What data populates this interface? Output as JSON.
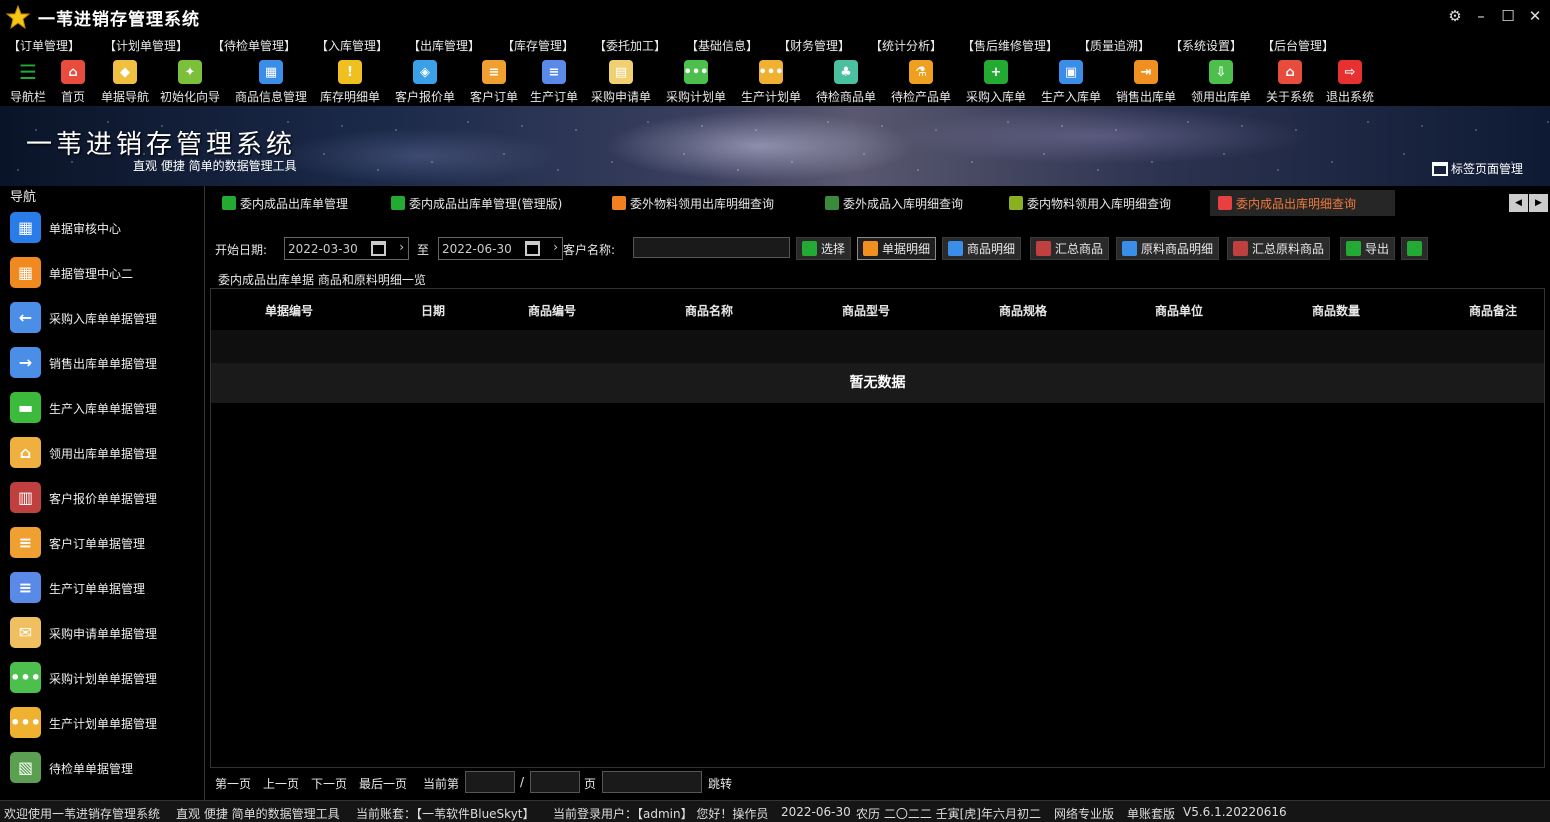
{
  "window": {
    "title": "一苇进销存管理系统",
    "controls": [
      "settings-icon",
      "minimize-icon",
      "maximize-icon",
      "close-icon"
    ]
  },
  "menu": [
    "【订单管理】",
    "【计划单管理】",
    "【待检单管理】",
    "【入库管理】",
    "【出库管理】",
    "【库存管理】",
    "【委托加工】",
    "【基础信息】",
    "【财务管理】",
    "【统计分析】",
    "【售后维修管理】",
    "【质量追溯】",
    "【系统设置】",
    "【后台管理】"
  ],
  "toolbar": [
    {
      "label": "导航栏",
      "icon": "menu-icon",
      "color": "#22aa33"
    },
    {
      "label": "首页",
      "icon": "home-icon",
      "color": "#e84c3d"
    },
    {
      "label": "单据导航",
      "icon": "compass-icon",
      "color": "#f0c040"
    },
    {
      "label": "初始化向导",
      "icon": "wand-icon",
      "color": "#7bbf3a"
    },
    {
      "label": "商品信息管理",
      "icon": "cubes-icon",
      "color": "#3a8ee8"
    },
    {
      "label": "库存明细单",
      "icon": "warning-icon",
      "color": "#f0c020"
    },
    {
      "label": "客户报价单",
      "icon": "tag-icon",
      "color": "#3aa0e8"
    },
    {
      "label": "客户订单",
      "icon": "document-icon",
      "color": "#f0a030"
    },
    {
      "label": "生产订单",
      "icon": "document-icon",
      "color": "#5a8ae8"
    },
    {
      "label": "采购申请单",
      "icon": "form-icon",
      "color": "#f0d070"
    },
    {
      "label": "采购计划单",
      "icon": "chat-icon",
      "color": "#4cbf4c"
    },
    {
      "label": "生产计划单",
      "icon": "chat-icon",
      "color": "#f0b030"
    },
    {
      "label": "待检商品单",
      "icon": "leaf-icon",
      "color": "#4ac0a0"
    },
    {
      "label": "待检产品单",
      "icon": "flask-icon",
      "color": "#f0a020"
    },
    {
      "label": "采购入库单",
      "icon": "plus-icon",
      "color": "#22aa33"
    },
    {
      "label": "生产入库单",
      "icon": "cart-icon",
      "color": "#3a8ee8"
    },
    {
      "label": "销售出库单",
      "icon": "export-icon",
      "color": "#f09020"
    },
    {
      "label": "领用出库单",
      "icon": "download-icon",
      "color": "#4cbf4c"
    },
    {
      "label": "关于系统",
      "icon": "home-icon",
      "color": "#e84c3d"
    },
    {
      "label": "退出系统",
      "icon": "exit-icon",
      "color": "#e83030"
    }
  ],
  "banner": {
    "title": "一苇进销存管理系统",
    "subtitle": "直观 便捷 简单的数据管理工具",
    "tab_manager": "标签页面管理"
  },
  "nav": {
    "title": "导航",
    "items": [
      {
        "label": "单据审核中心",
        "icon": "grid-icon",
        "color": "#2a7de8"
      },
      {
        "label": "单据管理中心二",
        "icon": "grid-icon",
        "color": "#f08a20"
      },
      {
        "label": "采购入库单单据管理",
        "icon": "arrow-left-icon",
        "color": "#4a8ee8"
      },
      {
        "label": "销售出库单单据管理",
        "icon": "arrow-right-icon",
        "color": "#4a8ee8"
      },
      {
        "label": "生产入库单单据管理",
        "icon": "folder-icon",
        "color": "#3cba3c"
      },
      {
        "label": "领用出库单单据管理",
        "icon": "house-icon",
        "color": "#f0b040"
      },
      {
        "label": "客户报价单单据管理",
        "icon": "books-icon",
        "color": "#c04040"
      },
      {
        "label": "客户订单单据管理",
        "icon": "document-icon",
        "color": "#f0a030"
      },
      {
        "label": "生产订单单据管理",
        "icon": "document-icon",
        "color": "#5a8ae8"
      },
      {
        "label": "采购申请单单据管理",
        "icon": "envelope-icon",
        "color": "#f0c060"
      },
      {
        "label": "采购计划单单据管理",
        "icon": "chat-icon",
        "color": "#4cbf4c"
      },
      {
        "label": "生产计划单单据管理",
        "icon": "chat-icon",
        "color": "#f0b030"
      },
      {
        "label": "待检单单据管理",
        "icon": "clipboard-icon",
        "color": "#5aa050"
      }
    ]
  },
  "tabs": [
    {
      "label": "委内成品出库单管理",
      "color": "#22aa33",
      "active": false
    },
    {
      "label": "委内成品出库单管理(管理版)",
      "color": "#22aa33",
      "active": false
    },
    {
      "label": "委外物料领用出库明细查询",
      "color": "#f08020",
      "active": false
    },
    {
      "label": "委外成品入库明细查询",
      "color": "#3a8a3a",
      "active": false
    },
    {
      "label": "委内物料领用入库明细查询",
      "color": "#8ab020",
      "active": false
    },
    {
      "label": "委内成品出库明细查询",
      "color": "#e84040",
      "active": true
    }
  ],
  "filter": {
    "start_label": "开始日期:",
    "start_date": "2022-03-30",
    "to_label": "至",
    "end_date": "2022-06-30",
    "customer_label": "客户名称:",
    "customer_value": "",
    "buttons": [
      {
        "label": "选择",
        "icon": "check-icon",
        "color": "#22aa33"
      },
      {
        "label": "单据明细",
        "icon": "list-icon",
        "color": "#f09020",
        "selected": true
      },
      {
        "label": "商品明细",
        "icon": "edit-icon",
        "color": "#3a8ee8"
      },
      {
        "label": "汇总商品",
        "icon": "summary-icon",
        "color": "#c04040"
      },
      {
        "label": "原料商品明细",
        "icon": "edit-icon",
        "color": "#3a8ee8"
      },
      {
        "label": "汇总原料商品",
        "icon": "summary-icon",
        "color": "#c04040"
      },
      {
        "label": "导出",
        "icon": "excel-icon",
        "color": "#22aa33"
      },
      {
        "label": "",
        "icon": "copy-icon",
        "color": "#22aa33"
      }
    ]
  },
  "group_label": "委内成品出库单据 商品和原料明细一览",
  "grid": {
    "columns": [
      "单据编号",
      "日期",
      "商品编号",
      "商品名称",
      "商品型号",
      "商品规格",
      "商品单位",
      "商品数量",
      "商品备注"
    ],
    "empty_text": "暂无数据"
  },
  "pager": {
    "first": "第一页",
    "prev": "上一页",
    "next": "下一页",
    "last": "最后一页",
    "current_label": "当前第",
    "slash": "/",
    "page_label": "页",
    "jump": "跳转"
  },
  "status": {
    "welcome": "欢迎使用一苇进销存管理系统",
    "slogan": "直观 便捷 简单的数据管理工具",
    "account_label": "当前账套：【一苇软件BlueSkyt】",
    "user_label": "当前登录用户：【admin】 您好！操作员",
    "date": "2022-06-30",
    "lunar": "农历 二〇二二 壬寅[虎]年六月初二",
    "edition": "网络专业版",
    "set_edition": "单账套版",
    "version": "V5.6.1.20220616"
  }
}
